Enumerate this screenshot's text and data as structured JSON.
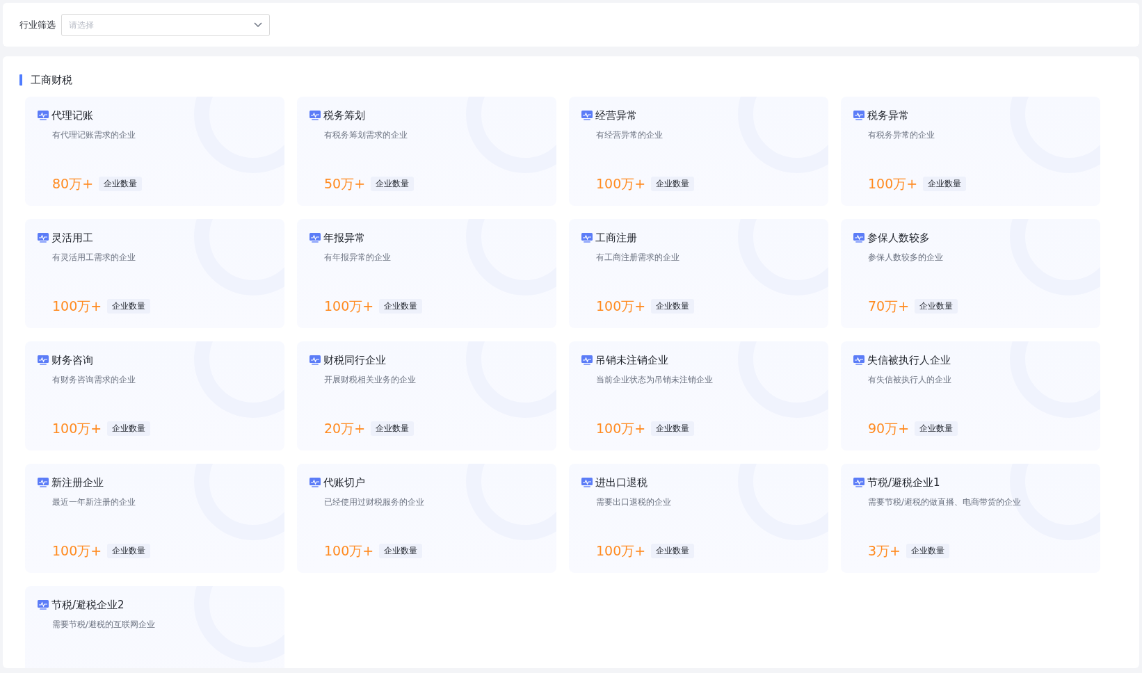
{
  "filter": {
    "label": "行业筛选",
    "placeholder": "请选择"
  },
  "section": {
    "title": "工商财税"
  },
  "cards": [
    {
      "title": "代理记账",
      "desc": "有代理记账需求的企业",
      "count": "80万+",
      "tag": "企业数量"
    },
    {
      "title": "税务筹划",
      "desc": "有税务筹划需求的企业",
      "count": "50万+",
      "tag": "企业数量"
    },
    {
      "title": "经营异常",
      "desc": "有经营异常的企业",
      "count": "100万+",
      "tag": "企业数量"
    },
    {
      "title": "税务异常",
      "desc": "有税务异常的企业",
      "count": "100万+",
      "tag": "企业数量"
    },
    {
      "title": "灵活用工",
      "desc": "有灵活用工需求的企业",
      "count": "100万+",
      "tag": "企业数量"
    },
    {
      "title": "年报异常",
      "desc": "有年报异常的企业",
      "count": "100万+",
      "tag": "企业数量"
    },
    {
      "title": "工商注册",
      "desc": "有工商注册需求的企业",
      "count": "100万+",
      "tag": "企业数量"
    },
    {
      "title": "参保人数较多",
      "desc": "参保人数较多的企业",
      "count": "70万+",
      "tag": "企业数量"
    },
    {
      "title": "财务咨询",
      "desc": "有财务咨询需求的企业",
      "count": "100万+",
      "tag": "企业数量"
    },
    {
      "title": "财税同行企业",
      "desc": "开展财税相关业务的企业",
      "count": "20万+",
      "tag": "企业数量"
    },
    {
      "title": "吊销未注销企业",
      "desc": "当前企业状态为吊销未注销企业",
      "count": "100万+",
      "tag": "企业数量"
    },
    {
      "title": "失信被执行人企业",
      "desc": "有失信被执行人的企业",
      "count": "90万+",
      "tag": "企业数量"
    },
    {
      "title": "新注册企业",
      "desc": "最近一年新注册的企业",
      "count": "100万+",
      "tag": "企业数量"
    },
    {
      "title": "代账切户",
      "desc": "已经使用过财税服务的企业",
      "count": "100万+",
      "tag": "企业数量"
    },
    {
      "title": "进出口退税",
      "desc": "需要出口退税的企业",
      "count": "100万+",
      "tag": "企业数量"
    },
    {
      "title": "节税/避税企业1",
      "desc": "需要节税/避税的做直播、电商带货的企业",
      "count": "3万+",
      "tag": "企业数量"
    },
    {
      "title": "节税/避税企业2",
      "desc": "需要节税/避税的互联网企业"
    }
  ]
}
